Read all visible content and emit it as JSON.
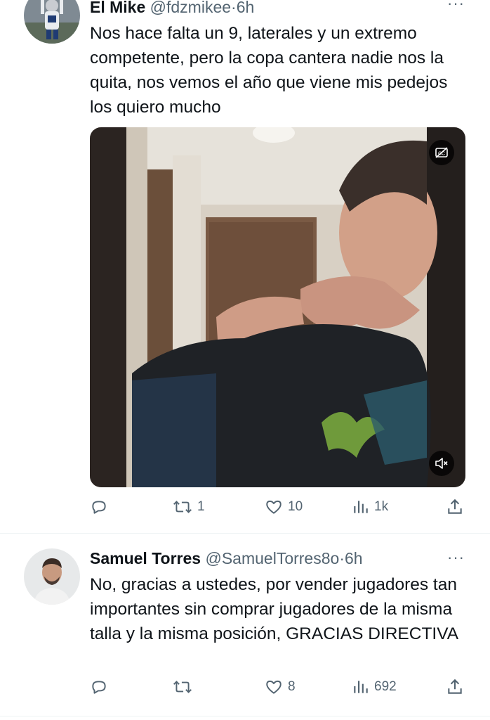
{
  "tweets": [
    {
      "author_name": "El Mike",
      "handle": "@fdzmikee",
      "separator": "·",
      "time": "6h",
      "more": "···",
      "text": "Nos hace falta un 9, laterales y un extremo competente, pero la copa cantera nadie nos la quita, nos vemos el año que viene mis pedejos los quiero mucho",
      "media": {
        "type": "video",
        "captions_icon": "captions-off-icon",
        "mute_icon": "muted-speaker-icon"
      },
      "stats": {
        "replies": "",
        "retweets": "1",
        "likes": "10",
        "views": "1k"
      }
    },
    {
      "author_name": "Samuel Torres",
      "handle": "@SamuelTorres8o",
      "separator": "·",
      "time": "6h",
      "more": "···",
      "text": "No, gracias a ustedes, por vender jugadores tan importantes sin comprar jugadores de la misma talla y la misma posición, GRACIAS DIRECTIVA",
      "stats": {
        "replies": "",
        "retweets": "",
        "likes": "8",
        "views": "692"
      }
    }
  ],
  "icons": [
    "reply-icon",
    "retweet-icon",
    "like-icon",
    "views-icon",
    "share-icon"
  ],
  "colors": {
    "text": "#0f1419",
    "secondary": "#536471",
    "divider": "#eff3f4",
    "background": "#ffffff"
  }
}
